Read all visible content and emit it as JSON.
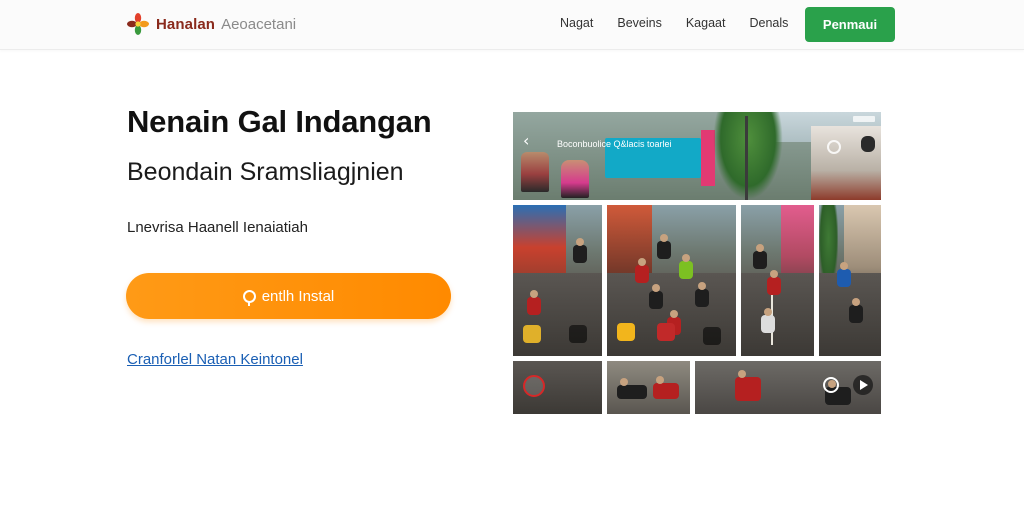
{
  "header": {
    "brand_name": "Hanalan",
    "brand_tagline": "Aeoacetani",
    "nav": [
      {
        "label": "Nagat"
      },
      {
        "label": "Beveins"
      },
      {
        "label": "Kagaat"
      },
      {
        "label": "Denals"
      }
    ],
    "cta_label": "Penmaui"
  },
  "hero": {
    "title": "Nenain Gal Indangan",
    "subtitle": "Beondain Sramsliagjnien",
    "description": "Lnevrisa Haanell Ienaiatiah",
    "install_label": "entlh Instal",
    "link_label": "Cranforlel Natan Keintonel"
  },
  "collage": {
    "overlay_text": "Boconbuolice Q&lacis toarlei"
  },
  "colors": {
    "brand_red": "#8a2a1c",
    "cta_green": "#2aa14b",
    "install_orange": "#ff8a00",
    "link_blue": "#1a5fb4"
  },
  "icons": {
    "logo": "flower-logo-icon",
    "install": "pin-icon",
    "back": "chevron-left-icon"
  }
}
